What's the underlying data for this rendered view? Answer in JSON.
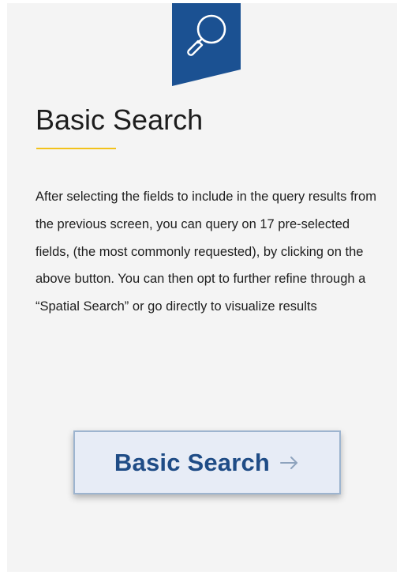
{
  "card": {
    "icon": "search-icon",
    "title": "Basic Search",
    "description": "After selecting the fields to include in the query results from the previous screen, you can query on 17 pre-selected fields, (the most commonly requested), by clicking on the above button. You can then opt to further refine through a “Spatial Search” or go directly to visualize results"
  },
  "button": {
    "label": "Basic Search",
    "icon": "arrow-right-icon"
  },
  "colors": {
    "ribbon": "#1b5192",
    "underline": "#f2c21b",
    "button_text": "#1f4c86",
    "button_bg": "#e7ecf6",
    "card_bg": "#f4f4f4"
  }
}
